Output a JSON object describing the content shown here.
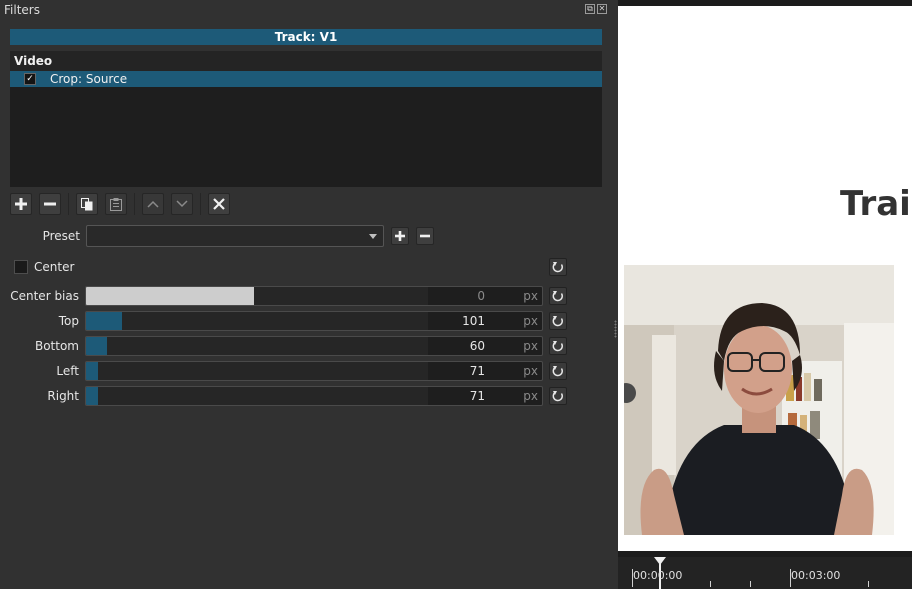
{
  "panel": {
    "title": "Filters"
  },
  "track": {
    "label": "Track: V1"
  },
  "filter_list": {
    "section": "Video",
    "items": [
      {
        "label": "Crop: Source",
        "checked": true,
        "checkmark": "✓"
      }
    ]
  },
  "toolbar": {
    "add": "add-icon",
    "remove": "remove-icon",
    "copy": "copy-icon",
    "paste": "paste-icon",
    "move_up": "chevron-up-icon",
    "move_down": "chevron-down-icon",
    "deselect": "close-icon"
  },
  "preset": {
    "label": "Preset",
    "value": ""
  },
  "center": {
    "label": "Center",
    "checked": false
  },
  "params": [
    {
      "label": "Center bias",
      "value": "0",
      "unit": "px",
      "fill_fraction": 0.49
    },
    {
      "label": "Top",
      "value": "101",
      "unit": "px",
      "fill_fraction": 0.105
    },
    {
      "label": "Bottom",
      "value": "60",
      "unit": "px",
      "fill_fraction": 0.06
    },
    {
      "label": "Left",
      "value": "71",
      "unit": "px",
      "fill_fraction": 0.035
    },
    {
      "label": "Right",
      "value": "71",
      "unit": "px",
      "fill_fraction": 0.035
    }
  ],
  "preview": {
    "title_text": "Train"
  },
  "timeline": {
    "start": "00:00:00",
    "mark": "00:03:00"
  },
  "colors": {
    "accent": "#1d5a78",
    "panel": "#313131",
    "list_bg": "#1e1e1e"
  }
}
